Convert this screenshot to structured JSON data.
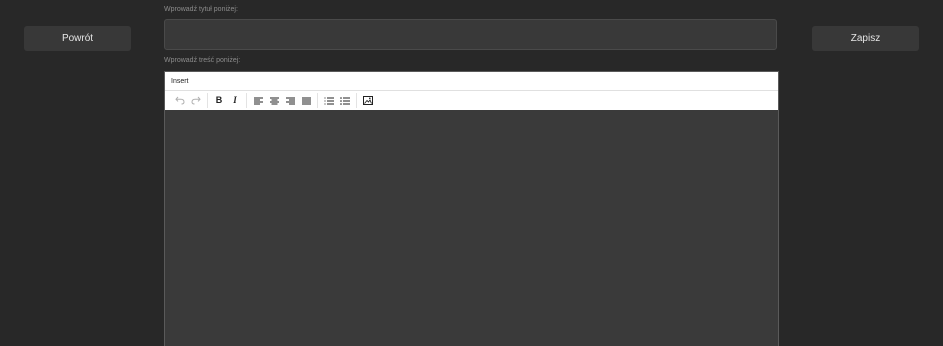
{
  "nav": {
    "back_label": "Powrót",
    "save_label": "Zapisz"
  },
  "title_field": {
    "label": "Wprowadź tytuł poniżej:",
    "value": ""
  },
  "content_field": {
    "label": "Wprowadź treść poniżej:",
    "value": ""
  },
  "editor": {
    "menubar": [
      "Insert"
    ],
    "toolbar_icons": [
      "undo-icon",
      "redo-icon",
      "bold-icon",
      "italic-icon",
      "align-left-icon",
      "align-center-icon",
      "align-right-icon",
      "align-justify-icon",
      "numbered-list-icon",
      "bullet-list-icon",
      "image-icon"
    ],
    "bold_glyph": "B",
    "italic_glyph": "I"
  },
  "colors": {
    "background": "#282828",
    "button": "#383838",
    "input": "#393939",
    "editor_area": "#3a3a3a",
    "toolbar": "#ffffff"
  }
}
